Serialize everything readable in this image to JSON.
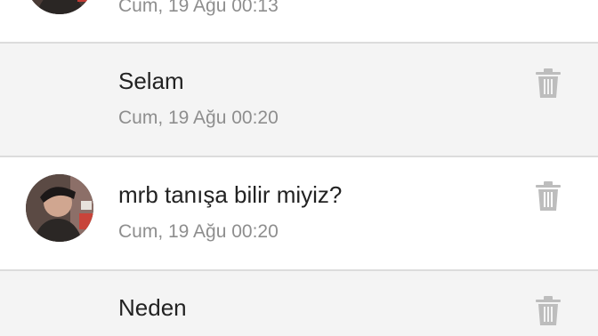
{
  "messages": [
    {
      "text": "",
      "time": "Cum, 19 Ağu 00:13",
      "has_avatar": true
    },
    {
      "text": "Selam",
      "time": "Cum, 19 Ağu 00:20",
      "has_avatar": false
    },
    {
      "text": "mrb tanışa bilir miyiz?",
      "time": "Cum, 19 Ağu 00:20",
      "has_avatar": true
    },
    {
      "text": "Neden",
      "time": "",
      "has_avatar": false
    }
  ],
  "icons": {
    "delete": "trash-icon"
  },
  "colors": {
    "own_message_bg": "#f4f4f4",
    "other_message_bg": "#ffffff",
    "divider": "#dcdcdc",
    "text": "#222222",
    "timestamp": "#8e8e8e",
    "icon": "#bdbdbd"
  }
}
